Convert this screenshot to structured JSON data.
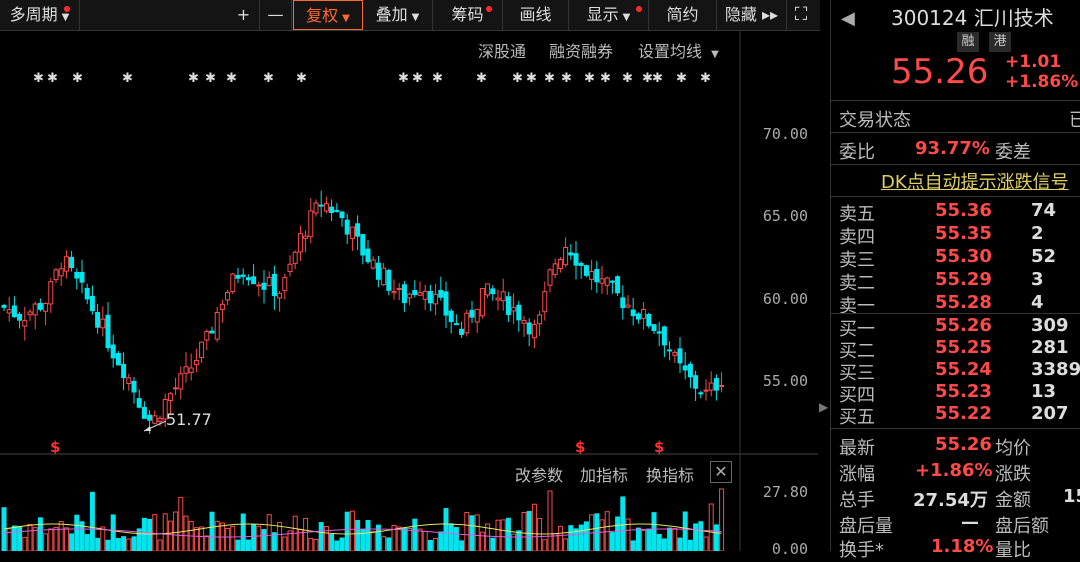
{
  "toolbar": {
    "items": [
      {
        "label": "多周期",
        "has_dot": true,
        "has_caret": true
      },
      {
        "label": "+",
        "has_dot": false
      },
      {
        "label": "—",
        "has_dot": false
      },
      {
        "label": "复权",
        "has_dot": false,
        "has_caret": true,
        "active": true
      },
      {
        "label": "叠加",
        "has_dot": false,
        "has_caret": true
      },
      {
        "label": "筹码",
        "has_dot": true
      },
      {
        "label": "画线",
        "has_dot": false
      },
      {
        "label": "显示",
        "has_dot": true,
        "has_caret": true
      },
      {
        "label": "简约",
        "has_dot": false
      },
      {
        "label": "隐藏",
        "has_dot": false
      }
    ]
  },
  "subbar": {
    "shgt": "深股通",
    "margin": "融资融券",
    "ma": "设置均线"
  },
  "price_axis": [
    "70.00",
    "65.00",
    "60.00",
    "55.00"
  ],
  "low_marker": "51.77",
  "sub_panel": {
    "buttons": [
      "改参数",
      "加指标",
      "换指标"
    ],
    "axis": [
      "27.80",
      "0.00"
    ]
  },
  "stock": {
    "code": "300124",
    "name": "汇川技术",
    "badges": [
      "融",
      "港"
    ],
    "price": "55.26",
    "change": "+1.01",
    "change_pct": "+1.86%"
  },
  "status": {
    "label": "交易状态",
    "value": "已"
  },
  "ratio": {
    "label": "委比",
    "value": "93.77%",
    "diff_label": "委差"
  },
  "dk_signal": "DK点自动提示涨跌信号",
  "order_book": {
    "asks": [
      {
        "name": "卖五",
        "price": "55.36",
        "vol": "74"
      },
      {
        "name": "卖四",
        "price": "55.35",
        "vol": "2"
      },
      {
        "name": "卖三",
        "price": "55.30",
        "vol": "52"
      },
      {
        "name": "卖二",
        "price": "55.29",
        "vol": "3"
      },
      {
        "name": "卖一",
        "price": "55.28",
        "vol": "4"
      }
    ],
    "bids": [
      {
        "name": "买一",
        "price": "55.26",
        "vol": "309"
      },
      {
        "name": "买二",
        "price": "55.25",
        "vol": "281"
      },
      {
        "name": "买三",
        "price": "55.24",
        "vol": "3389"
      },
      {
        "name": "买四",
        "price": "55.23",
        "vol": "13"
      },
      {
        "name": "买五",
        "price": "55.22",
        "vol": "207"
      }
    ]
  },
  "quote": {
    "latest_label": "最新",
    "latest": "55.26",
    "avg_label": "均价",
    "chg_label": "涨幅",
    "chg": "+1.86%",
    "updown_label": "涨跌",
    "vol_label": "总手",
    "vol": "27.54万",
    "amount_label": "金额",
    "amount": "15",
    "after_label": "盘后量",
    "after": "—",
    "after_amt_label": "盘后额",
    "turnover_label": "换手*",
    "turnover": "1.18%",
    "ratio_label": "量比"
  },
  "colors": {
    "up": "#ff4a4a",
    "down": "#00e5ee",
    "accent": "#ff6a30"
  }
}
